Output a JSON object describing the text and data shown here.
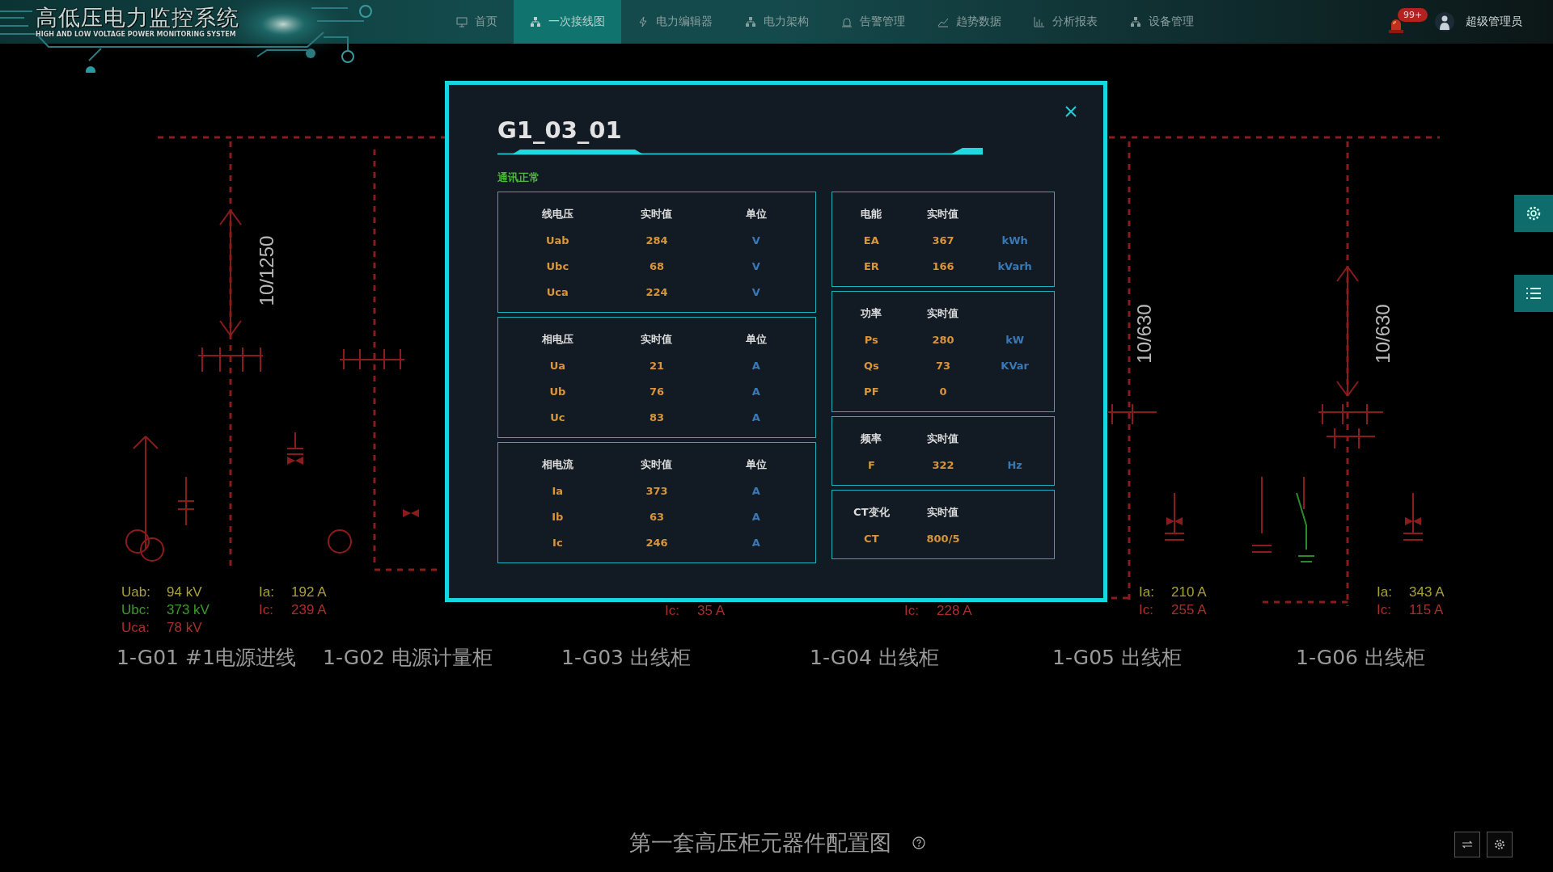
{
  "header": {
    "title": "高低压电力监控系统",
    "subtitle": "HIGH AND LOW VOLTAGE POWER MONITORING SYSTEM",
    "nav": [
      {
        "label": "首页",
        "selected": false
      },
      {
        "label": "一次接线图",
        "selected": true
      },
      {
        "label": "电力编辑器",
        "selected": false
      },
      {
        "label": "电力架构",
        "selected": false
      },
      {
        "label": "告警管理",
        "selected": false
      },
      {
        "label": "趋势数据",
        "selected": false
      },
      {
        "label": "分析报表",
        "selected": false
      },
      {
        "label": "设备管理",
        "selected": false
      }
    ],
    "alarm_badge": "99+",
    "user": "超级管理员"
  },
  "diagram": {
    "ratings": [
      "10/1250",
      "10/630",
      "10/630"
    ],
    "readings": [
      {
        "rows": [
          {
            "label": "Uab:",
            "value": "94 kV",
            "color": "#a8a236"
          },
          {
            "label": "Ubc:",
            "value": "373 kV",
            "color": "#3c9a2c"
          },
          {
            "label": "Uca:",
            "value": "78 kV",
            "color": "#a8302c"
          }
        ]
      },
      {
        "rows": [
          {
            "label": "Ia:",
            "value": "192 A",
            "color": "#a8a236"
          },
          {
            "label": "Ic:",
            "value": "239 A",
            "color": "#a8302c"
          }
        ]
      },
      {
        "rows": [
          {
            "label": "Ic:",
            "value": "35 A",
            "color": "#a8302c"
          }
        ]
      },
      {
        "rows": [
          {
            "label": "Ic:",
            "value": "228 A",
            "color": "#a8302c"
          }
        ]
      },
      {
        "rows": [
          {
            "label": "Ia:",
            "value": "210 A",
            "color": "#a8a236"
          },
          {
            "label": "Ic:",
            "value": "255 A",
            "color": "#a8302c"
          }
        ]
      },
      {
        "rows": [
          {
            "label": "Ia:",
            "value": "343 A",
            "color": "#a8a236"
          },
          {
            "label": "Ic:",
            "value": "115 A",
            "color": "#a8302c"
          }
        ]
      }
    ],
    "feeders": [
      "1-G01 #1电源进线",
      "1-G02 电源计量柜",
      "1-G03 出线柜",
      "1-G04 出线柜",
      "1-G05 出线柜",
      "1-G06 出线柜"
    ]
  },
  "modal": {
    "title": "G1_03_01",
    "status": "通讯正常",
    "left_tables": [
      {
        "columns": [
          "线电压",
          "实时值",
          "单位"
        ],
        "rows": [
          {
            "name": "Uab",
            "value": "284",
            "unit": "V"
          },
          {
            "name": "Ubc",
            "value": "68",
            "unit": "V"
          },
          {
            "name": "Uca",
            "value": "224",
            "unit": "V"
          }
        ]
      },
      {
        "columns": [
          "相电压",
          "实时值",
          "单位"
        ],
        "rows": [
          {
            "name": "Ua",
            "value": "21",
            "unit": "A"
          },
          {
            "name": "Ub",
            "value": "76",
            "unit": "A"
          },
          {
            "name": "Uc",
            "value": "83",
            "unit": "A"
          }
        ]
      },
      {
        "columns": [
          "相电流",
          "实时值",
          "单位"
        ],
        "rows": [
          {
            "name": "Ia",
            "value": "373",
            "unit": "A"
          },
          {
            "name": "Ib",
            "value": "63",
            "unit": "A"
          },
          {
            "name": "Ic",
            "value": "246",
            "unit": "A"
          }
        ]
      }
    ],
    "right_tables": [
      {
        "columns": [
          "电能",
          "实时值"
        ],
        "rows": [
          {
            "name": "EA",
            "value": "367",
            "unit": "kWh"
          },
          {
            "name": "ER",
            "value": "166",
            "unit": "kVarh"
          }
        ]
      },
      {
        "columns": [
          "功率",
          "实时值"
        ],
        "rows": [
          {
            "name": "Ps",
            "value": "280",
            "unit": "kW"
          },
          {
            "name": "Qs",
            "value": "73",
            "unit": "KVar"
          },
          {
            "name": "PF",
            "value": "0"
          }
        ]
      },
      {
        "columns": [
          "频率",
          "实时值"
        ],
        "rows": [
          {
            "name": "F",
            "value": "322",
            "unit": "Hz"
          }
        ]
      },
      {
        "columns": [
          "CT变化",
          "实时值"
        ],
        "rows": [
          {
            "name": "CT",
            "value": "800/5"
          }
        ]
      }
    ]
  },
  "footer": {
    "title": "第一套高压柜元器件配置图"
  }
}
